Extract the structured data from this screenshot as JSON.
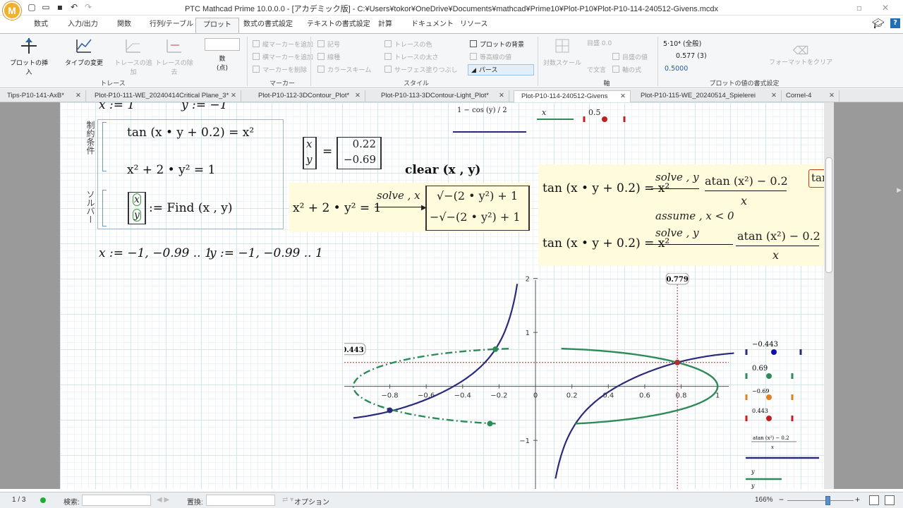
{
  "window": {
    "title": "PTC Mathcad Prime 10.0.0.0 - [アカデミック版] - C:¥Users¥tokor¥OneDrive¥Documents¥mathcad¥Prime10¥Plot-P10¥Plot-P10-114-240512-Givens.mcdx",
    "logo": "M"
  },
  "ribbon_tabs": [
    "数式",
    "入力/出力",
    "関数",
    "行列/テーブル",
    "プロット",
    "数式の書式設定",
    "テキストの書式設定",
    "計算",
    "ドキュメント",
    "リソース"
  ],
  "ribbon": {
    "insert_plot": "プロットの挿入",
    "change_type": "タイプの変更",
    "add_trace": "トレースの追加",
    "remove_trace": "トレースの除去",
    "numbers_label": "数\n(点)",
    "group_trace": "トレース",
    "marker_v_add": "縦マーカーを追加",
    "marker_h_add": "横マーカーを追加",
    "marker_delete": "マーカーを削除",
    "group_marker": "マーカー",
    "symbol": "記号",
    "line": "線種",
    "colorscheme": "カラースキーム",
    "trace_color": "トレースの色",
    "trace_width": "トレースの太さ",
    "surface_fill": "サーフェス塗りつぶし",
    "group_style": "スタイル",
    "plot_bg": "プロットの背景",
    "contour_value": "等高線の値",
    "perspective": "パース",
    "sym_scale": "対数スケール",
    "label_00": "目盛 0.0",
    "label_adjust": "で文言",
    "axis_value": "目盛の値",
    "axis_expr": "軸の式",
    "group_axis": "軸",
    "fmt1": "5·10⁴ (全般)",
    "fmt2": "0.577 (3)",
    "fmt3": "0.5000",
    "clear_format": "フォーマットをクリア",
    "group_format": "プロットの値の書式設定"
  },
  "doc_tabs": [
    "Tips-P10-141-AxB*",
    "Plot-P10-111-WE_20240414Critical Plane_3*",
    "Plot-P10-112-3DContour_Plot*",
    "Plot-P10-113-3DContour-Light_Plot*",
    "Plot-P10-114-240512-Givens",
    "Plot-P10-115-WE_20240514_Spielerei",
    "Cornel-4"
  ],
  "math": {
    "xdef": "x := 1",
    "ydef": "y := −1",
    "constraint_label": "制約条件",
    "solver_label": "ソルバー",
    "eq1": "tan (x • y + 0.2) = x²",
    "eq2": "x² + 2 • y² = 1",
    "find": ":= Find (x , y)",
    "result_x": "0.22",
    "result_y": "−0.69",
    "clear": "clear (x , y)",
    "solve_lhs": "x² + 2 • y² = 1",
    "solve_op": "solve , x",
    "solve_r1": "√−(2 • y²) + 1",
    "solve_r2": "−√−(2 • y²) + 1",
    "solve2_lhs": "tan (x • y + 0.2) = x²",
    "solve2_op": "solve , y",
    "solve2_rhs_num": "atan (x²) − 0.2",
    "solve2_rhs_den": "x",
    "assume": "assume , x < 0",
    "range_x": "x := −1, −0.99 .. 1",
    "range_y": "y := −1, −0.99 .. 1",
    "top_expr": "1 − cos (y) / 2",
    "top_x": "x",
    "top_05": "0.5",
    "cut_right": "tar"
  },
  "chart_data": {
    "type": "line",
    "xlim": [
      -1.05,
      1.1
    ],
    "ylim": [
      -1.9,
      2.1
    ],
    "x_ticks": [
      -0.8,
      -0.6,
      -0.4,
      -0.2,
      0,
      0.2,
      0.4,
      0.6,
      0.8,
      1
    ],
    "y_ticks": [
      -1,
      0,
      1,
      2
    ],
    "markers": {
      "x_value": "0.779",
      "y_value": "0.443"
    },
    "series": [
      {
        "color": "#2b2b7a",
        "style": "solid",
        "kind": "y(x)=(atan(x^2)-0.2)/x"
      },
      {
        "color": "#2e8b57",
        "style": "solid",
        "kind": "x=sqrt(1-2y^2)"
      },
      {
        "color": "#2e8b57",
        "style": "dashdot",
        "kind": "x=-sqrt(1-2y^2)"
      }
    ],
    "points": [
      {
        "x": 0.779,
        "y": 0.443,
        "color": "#b03030"
      },
      {
        "x": -0.22,
        "y": 0.69,
        "color": "#2e8b57"
      },
      {
        "x": -0.25,
        "y": -0.69,
        "color": "#2e8b57"
      },
      {
        "x": -0.8,
        "y": -0.443,
        "color": "#2b2b7a"
      }
    ]
  },
  "legend": {
    "v1": "−0.443",
    "v2": "0.69",
    "v3": "−0.69",
    "v4": "0.443",
    "fx_num": "atan (x²) − 0.2",
    "fx_den": "x",
    "y1": "y",
    "y2": "y"
  },
  "status": {
    "page": "1 / 3",
    "search": "検索:",
    "replace": "置換:",
    "option": "オプション",
    "zoom": "166%"
  }
}
